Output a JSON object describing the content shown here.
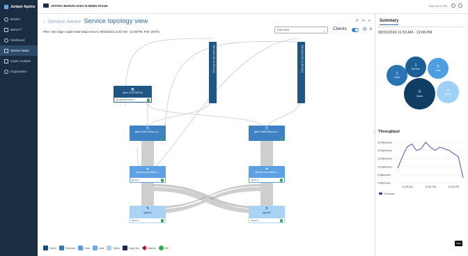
{
  "brand": {
    "name": "Juniper Apstra"
  },
  "sidebar": {
    "items": [
      {
        "label": "Monitor",
        "icon": "monitor-icon"
      },
      {
        "label": "Marvis™",
        "icon": "marvis-icon"
      },
      {
        "label": "Dashboard",
        "icon": "dashboard-icon"
      },
      {
        "label": "Service Aware",
        "icon": "service-aware-icon"
      },
      {
        "label": "Impact Analysis",
        "icon": "impact-analysis-icon"
      },
      {
        "label": "Organization",
        "icon": "organization-icon"
      }
    ]
  },
  "topbar": {
    "blueprint": "APSTRA-MARVIS-SAEC-N-DEMO-STAGE",
    "time": "Time 12:11 PM"
  },
  "header": {
    "crumb": "Service Aware",
    "title": "Service topology view",
    "filter": "Filter: Site:edge-1-gate-Gate-setup-venu-0, 08/15/2024 11:53 AM - 12:08 PM, Port: (3074)"
  },
  "controls": {
    "view_select": "Flow View",
    "clients_label": "Clients"
  },
  "topology": {
    "clients": [
      {
        "label": "100.100.100.10.3074(1)"
      },
      {
        "label": "100.100.100.11.3074(1)"
      }
    ],
    "xbox": {
      "title": "xbox (TCP/3074)",
      "addr": "200.200.200.10:3074"
    },
    "services": [
      {
        "label": "gate-Gate-setup-ve..."
      },
      {
        "label": "gate-Gate-setup-ve..."
      }
    ],
    "leafs": [
      {
        "label": "qfx/ncs-vsrx-lfasf-9...",
        "issues": "Issues: 0"
      },
      {
        "label": "qfx/ncs-vsrx-lfasf-9...",
        "issues": "Issues: 0"
      }
    ],
    "spines": [
      {
        "label": "spine1",
        "issues": "Issues: 0"
      },
      {
        "label": "spine2",
        "issues": "Issues: 0"
      }
    ]
  },
  "legend": [
    {
      "label": "Client",
      "color": "#1b4f7a"
    },
    {
      "label": "Services",
      "color": "#3a78b5"
    },
    {
      "label": "Host",
      "color": "#5b9ad8"
    },
    {
      "label": "Leaf",
      "color": "#6aaae6"
    },
    {
      "label": "Spine",
      "color": "#a7d2f5"
    },
    {
      "label": "Lag Link",
      "color": "#1b2d43"
    },
    {
      "label": "Issues",
      "color": "#b22222"
    },
    {
      "label": "OK",
      "color": "#3aa655"
    }
  ],
  "summary": {
    "tab": "Summary",
    "range": "08/15/2024 11:53 AM - 12:08 PM",
    "bubbles": [
      {
        "count": "1",
        "label": "Service"
      },
      {
        "count": "1",
        "label": "Host"
      },
      {
        "count": "2",
        "label": "Leaf"
      },
      {
        "count": "9",
        "label": "Client"
      },
      {
        "count": "2",
        "label": "Spine"
      }
    ]
  },
  "throughput": {
    "title": "Throughput",
    "hide_label": "HIDE"
  },
  "chart_data": {
    "type": "line",
    "title": "Throughput",
    "yticks": [
      "25 Bytes/sec",
      "20 Bytes/sec",
      "15 Bytes/sec",
      "10 Bytes/sec",
      "5 Bytes/sec",
      "0 Bytes/sec"
    ],
    "xticks": [
      "11:55 AM",
      "12:00 PM",
      "12:05 PM"
    ],
    "ylim": [
      0,
      25
    ],
    "series": [
      {
        "name": "Services",
        "color": "#3f39a8",
        "x": [
          0,
          1,
          2,
          3,
          4,
          5,
          6,
          7,
          8,
          9,
          10,
          11,
          12,
          13,
          14
        ],
        "y": [
          9,
          16,
          22,
          24,
          20,
          21,
          25,
          22,
          20,
          22,
          21,
          20,
          18,
          16,
          3
        ]
      }
    ]
  }
}
